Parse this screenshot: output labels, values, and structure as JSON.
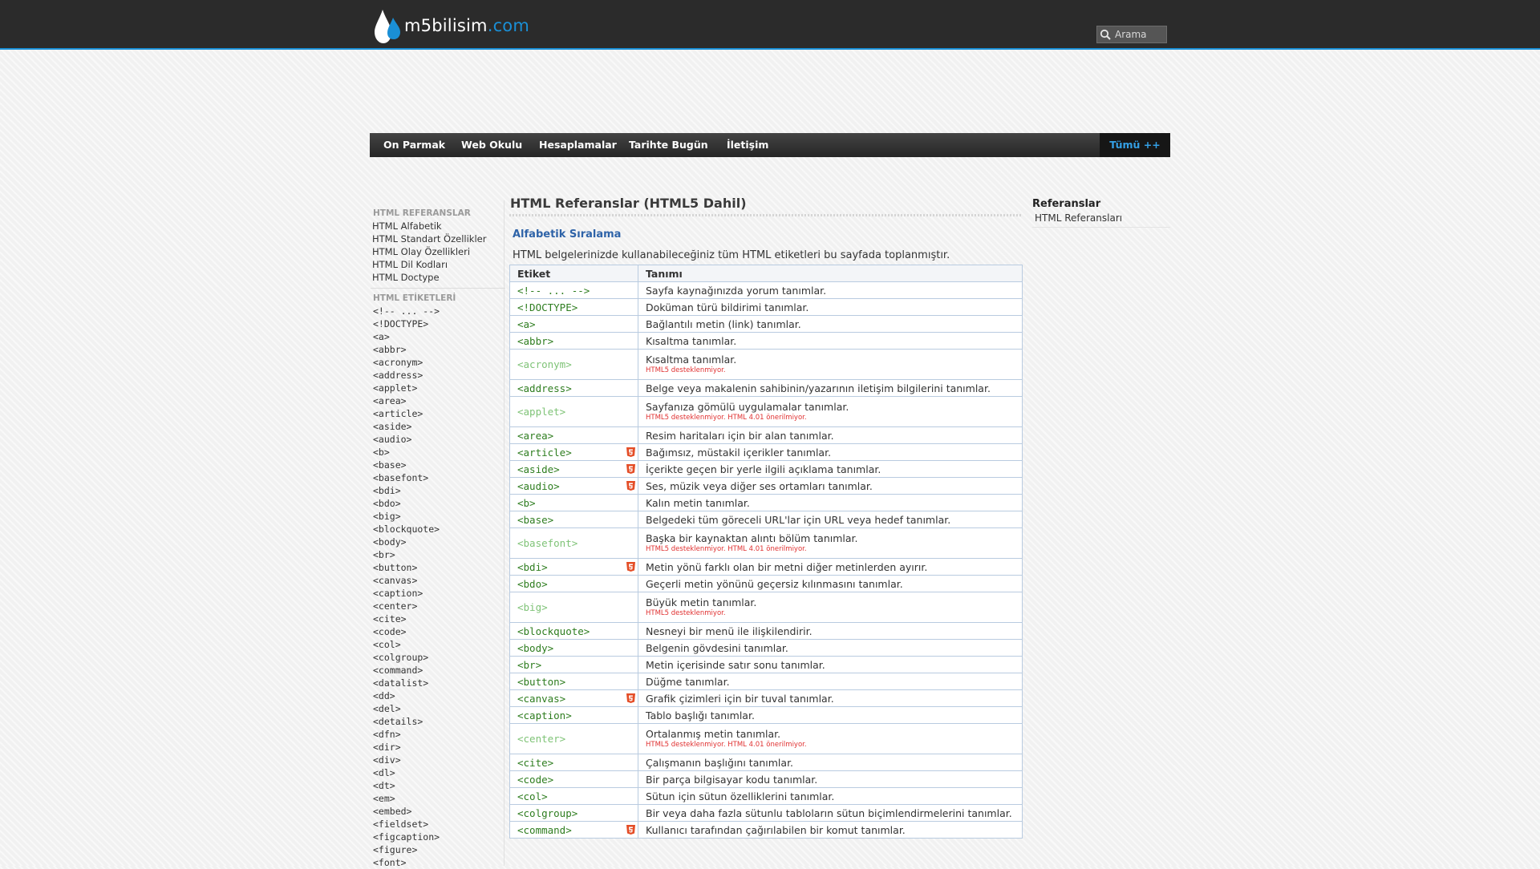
{
  "header": {
    "logo_text_main": "m5bilisim",
    "logo_text_dot": ".com",
    "search_placeholder": "Arama"
  },
  "nav": {
    "items": [
      "On Parmak",
      "Web Okulu",
      "Hesaplamalar",
      "Tarihte Bugün",
      "İletişim"
    ],
    "all_label": "Tümü ++"
  },
  "sidebar": {
    "section1_title": "HTML REFERANSLAR",
    "section1_links": [
      "HTML Alfabetik",
      "HTML Standart Özellikler",
      "HTML Olay Özellikleri",
      "HTML Dil Kodları",
      "HTML Doctype"
    ],
    "section2_title": "HTML ETİKETLERİ",
    "tags": [
      "<!-- ... -->",
      "<!DOCTYPE>",
      "<a>",
      "<abbr>",
      "<acronym>",
      "<address>",
      "<applet>",
      "<area>",
      "<article>",
      "<aside>",
      "<audio>",
      "<b>",
      "<base>",
      "<basefont>",
      "<bdi>",
      "<bdo>",
      "<big>",
      "<blockquote>",
      "<body>",
      "<br>",
      "<button>",
      "<canvas>",
      "<caption>",
      "<center>",
      "<cite>",
      "<code>",
      "<col>",
      "<colgroup>",
      "<command>",
      "<datalist>",
      "<dd>",
      "<del>",
      "<details>",
      "<dfn>",
      "<dir>",
      "<div>",
      "<dl>",
      "<dt>",
      "<em>",
      "<embed>",
      "<fieldset>",
      "<figcaption>",
      "<figure>",
      "<font>"
    ]
  },
  "main": {
    "title": "HTML Referanslar (HTML5 Dahil)",
    "subtitle": "Alfabetik Sıralama",
    "intro": "HTML belgelerinizde kullanabileceğiniz tüm HTML etiketleri bu sayfada toplanmıştır.",
    "col_tag": "Etiket",
    "col_desc": "Tanımı",
    "rows": [
      {
        "tag": "<!-- ... -->",
        "desc": "Sayfa kaynağınızda yorum tanımlar."
      },
      {
        "tag": "<!DOCTYPE>",
        "desc": "Doküman türü bildirimi tanımlar."
      },
      {
        "tag": "<a>",
        "desc": "Bağlantılı metin (link) tanımlar."
      },
      {
        "tag": "<abbr>",
        "desc": "Kısaltma tanımlar."
      },
      {
        "tag": "<acronym>",
        "desc": "Kısaltma tanımlar.",
        "note": "HTML5 desteklenmiyor.",
        "deprecated": true
      },
      {
        "tag": "<address>",
        "desc": "Belge veya makalenin sahibinin/yazarının iletişim bilgilerini tanımlar."
      },
      {
        "tag": "<applet>",
        "desc": "Sayfanıza gömülü uygulamalar tanımlar.",
        "note": "HTML5 desteklenmiyor. HTML 4.01 önerilmiyor.",
        "deprecated": true
      },
      {
        "tag": "<area>",
        "desc": "Resim haritaları için bir alan tanımlar."
      },
      {
        "tag": "<article>",
        "desc": "Bağımsız, müstakil içerikler tanımlar.",
        "html5": true
      },
      {
        "tag": "<aside>",
        "desc": "İçerikte geçen bir yerle ilgili açıklama tanımlar.",
        "html5": true
      },
      {
        "tag": "<audio>",
        "desc": "Ses, müzik veya diğer ses ortamları tanımlar.",
        "html5": true
      },
      {
        "tag": "<b>",
        "desc": "Kalın metin tanımlar."
      },
      {
        "tag": "<base>",
        "desc": "Belgedeki tüm göreceli URL'lar için URL veya hedef tanımlar."
      },
      {
        "tag": "<basefont>",
        "desc": "Başka bir kaynaktan alıntı bölüm tanımlar.",
        "note": "HTML5 desteklenmiyor. HTML 4.01 önerilmiyor.",
        "deprecated": true
      },
      {
        "tag": "<bdi>",
        "desc": "Metin yönü farklı olan bir metni diğer metinlerden ayırır.",
        "html5": true
      },
      {
        "tag": "<bdo>",
        "desc": "Geçerli metin yönünü geçersiz kılınmasını tanımlar."
      },
      {
        "tag": "<big>",
        "desc": "Büyük metin tanımlar.",
        "note": "HTML5 desteklenmiyor.",
        "deprecated": true
      },
      {
        "tag": "<blockquote>",
        "desc": "Nesneyi bir menü ile ilişkilendirir."
      },
      {
        "tag": "<body>",
        "desc": "Belgenin gövdesini tanımlar."
      },
      {
        "tag": "<br>",
        "desc": "Metin içerisinde satır sonu tanımlar."
      },
      {
        "tag": "<button>",
        "desc": "Düğme tanımlar."
      },
      {
        "tag": "<canvas>",
        "desc": "Grafik çizimleri için bir tuval tanımlar.",
        "html5": true
      },
      {
        "tag": "<caption>",
        "desc": "Tablo başlığı tanımlar."
      },
      {
        "tag": "<center>",
        "desc": "Ortalanmış metin tanımlar.",
        "note": "HTML5 desteklenmiyor. HTML 4.01 önerilmiyor.",
        "deprecated": true
      },
      {
        "tag": "<cite>",
        "desc": "Çalışmanın başlığını tanımlar."
      },
      {
        "tag": "<code>",
        "desc": "Bir parça bilgisayar kodu tanımlar."
      },
      {
        "tag": "<col>",
        "desc": "Sütun için sütun özelliklerini tanımlar."
      },
      {
        "tag": "<colgroup>",
        "desc": "Bir veya daha fazla sütunlu tabloların sütun biçimlendirmelerini tanımlar."
      },
      {
        "tag": "<command>",
        "desc": "Kullanıcı tarafından çağırılabilen bir komut tanımlar.",
        "html5": true
      }
    ]
  },
  "right": {
    "title": "Referanslar",
    "link": "HTML Referansları"
  },
  "colors": {
    "accent": "#1a8fd6",
    "tag_green": "#2e7d1f",
    "deprecated_green": "#7fc377",
    "note_red": "#e03030",
    "html5_badge": "#e44d26"
  }
}
